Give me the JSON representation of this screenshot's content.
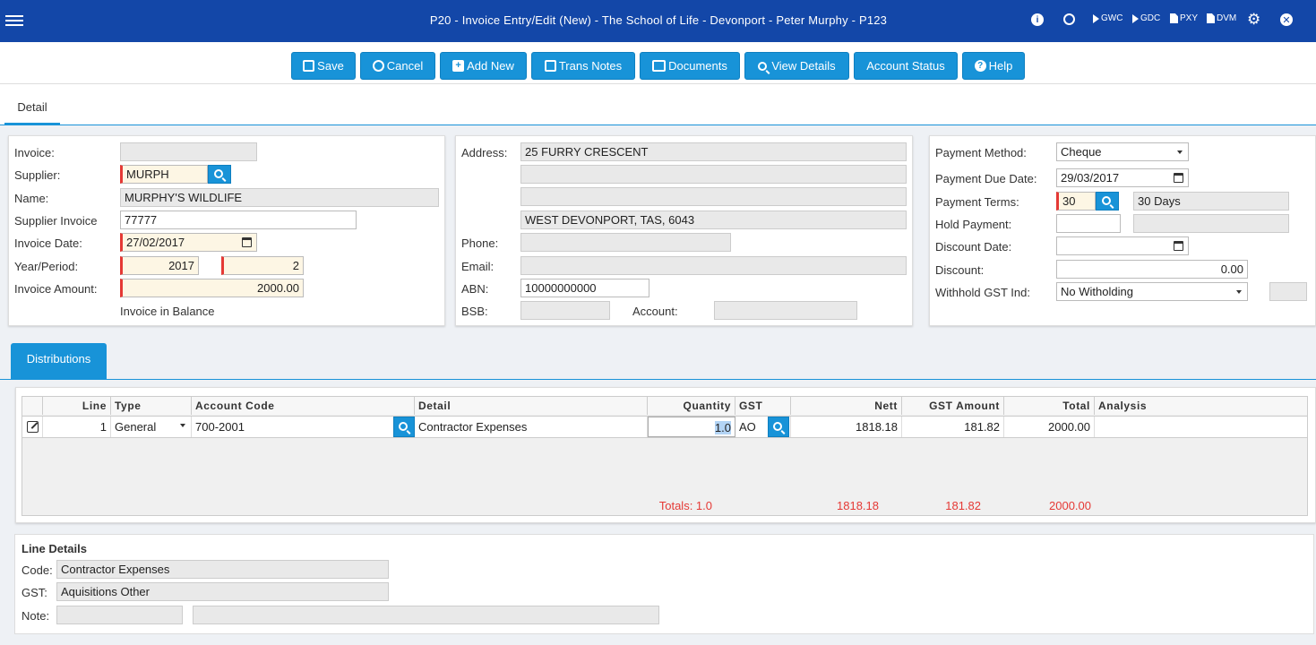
{
  "header": {
    "title": "P20 - Invoice Entry/Edit (New) - The School of Life - Devonport - Peter Murphy - P123",
    "shortcuts": [
      "GWC",
      "GDC",
      "PXY",
      "DVM"
    ]
  },
  "toolbar": {
    "save": "Save",
    "cancel": "Cancel",
    "add_new": "Add New",
    "trans_notes": "Trans Notes",
    "documents": "Documents",
    "view_details": "View Details",
    "account_status": "Account Status",
    "help": "Help"
  },
  "tabs": {
    "detail": "Detail",
    "distributions": "Distributions"
  },
  "invoice": {
    "invoice_label": "Invoice:",
    "invoice_value": "",
    "supplier_label": "Supplier:",
    "supplier_value": "MURPH",
    "name_label": "Name:",
    "name_value": "MURPHY'S WILDLIFE",
    "supplier_invoice_label": "Supplier Invoice",
    "supplier_invoice_value": "77777",
    "invoice_date_label": "Invoice Date:",
    "invoice_date_value": "27/02/2017",
    "year_period_label": "Year/Period:",
    "year_value": "2017",
    "period_value": "2",
    "amount_label": "Invoice Amount:",
    "amount_value": "2000.00",
    "balance_status": "Invoice in Balance"
  },
  "address": {
    "address_label": "Address:",
    "line1": "25 FURRY CRESCENT",
    "line2": "",
    "line3": "",
    "line4": "WEST DEVONPORT, TAS, 6043",
    "phone_label": "Phone:",
    "phone_value": "",
    "email_label": "Email:",
    "email_value": "",
    "abn_label": "ABN:",
    "abn_value": "10000000000",
    "bsb_label": "BSB:",
    "bsb_value": "",
    "account_label": "Account:",
    "account_value": ""
  },
  "payment": {
    "method_label": "Payment Method:",
    "method_value": "Cheque",
    "due_date_label": "Payment Due Date:",
    "due_date_value": "29/03/2017",
    "terms_label": "Payment Terms:",
    "terms_code": "30",
    "terms_desc": "30 Days",
    "hold_label": "Hold Payment:",
    "hold_value": "",
    "hold_desc": "",
    "discount_date_label": "Discount Date:",
    "discount_date_value": "",
    "discount_label": "Discount:",
    "discount_value": "0.00",
    "withhold_label": "Withhold GST Ind:",
    "withhold_value": "No Witholding",
    "withhold_extra": ""
  },
  "distributions": {
    "columns": [
      "Line",
      "Type",
      "Account Code",
      "Detail",
      "Quantity",
      "GST",
      "Nett",
      "GST Amount",
      "Total",
      "Analysis"
    ],
    "rows": [
      {
        "line": "1",
        "type": "General",
        "account_code": "700-2001",
        "detail": "Contractor Expenses",
        "quantity": "1.0",
        "gst": "AO",
        "nett": "1818.18",
        "gst_amount": "181.82",
        "total": "2000.00",
        "analysis": ""
      }
    ],
    "totals": {
      "label": "Totals: 1.0",
      "nett": "1818.18",
      "gst_amount": "181.82",
      "total": "2000.00"
    }
  },
  "line_details": {
    "title": "Line Details",
    "code_label": "Code:",
    "code_value": "Contractor Expenses",
    "gst_label": "GST:",
    "gst_value": "Aquisitions Other",
    "note_label": "Note:",
    "note_value1": "",
    "note_value2": ""
  },
  "colors": {
    "header": "#1347a8",
    "accent": "#1893d8",
    "required": "#e53935",
    "totals": "#e53935"
  }
}
